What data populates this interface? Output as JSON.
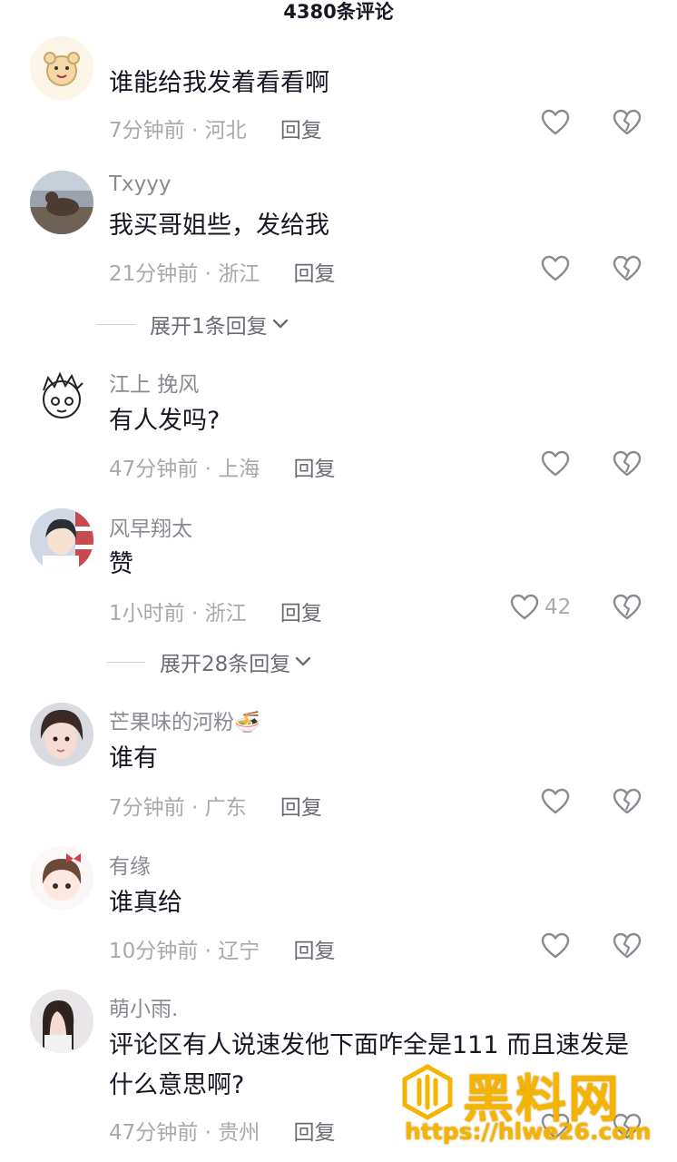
{
  "header": {
    "title": "4380条评论"
  },
  "comments": [
    {
      "username": "",
      "text": "谁能给我发着看看啊",
      "time": "7分钟前",
      "location": "河北",
      "reply": "回复",
      "likes": "",
      "avatar": "cartoon-bear"
    },
    {
      "username": "Txyyy",
      "text": "我买哥姐些，发给我",
      "time": "21分钟前",
      "location": "浙江",
      "reply": "回复",
      "likes": "",
      "avatar": "photo-cat"
    },
    {
      "username": "江上 挽风",
      "text": "有人发吗?",
      "time": "47分钟前",
      "location": "上海",
      "reply": "回复",
      "likes": "",
      "avatar": "sketch-face"
    },
    {
      "username": "风早翔太",
      "text": "赞",
      "time": "1小时前",
      "location": "浙江",
      "reply": "回复",
      "likes": "42",
      "avatar": "anime-boy"
    },
    {
      "username": "芒果味的河粉🍜",
      "text": "谁有",
      "time": "7分钟前",
      "location": "广东",
      "reply": "回复",
      "likes": "",
      "avatar": "photo-girl"
    },
    {
      "username": "有缘",
      "text": "谁真给",
      "time": "10分钟前",
      "location": "辽宁",
      "reply": "回复",
      "likes": "",
      "avatar": "chibi-girl"
    },
    {
      "username": "萌小雨.",
      "text": "评论区有人说速发他下面咋全是111 而且速发是什么意思啊?",
      "time": "47分钟前",
      "location": "贵州",
      "reply": "回复",
      "likes": "",
      "avatar": "photo-woman"
    }
  ],
  "expanders": [
    {
      "label": "展开1条回复"
    },
    {
      "label": "展开28条回复"
    }
  ],
  "watermark": {
    "title": "黑料网",
    "url": "https://hlwe26.com"
  },
  "colors": {
    "text": "#161823",
    "muted": "#a8a9ad",
    "username": "#8a8b91",
    "watermark": "#f4b400"
  },
  "icons": {
    "like": "heart-outline-icon",
    "dislike": "broken-heart-icon",
    "expand": "chevron-down-icon"
  }
}
